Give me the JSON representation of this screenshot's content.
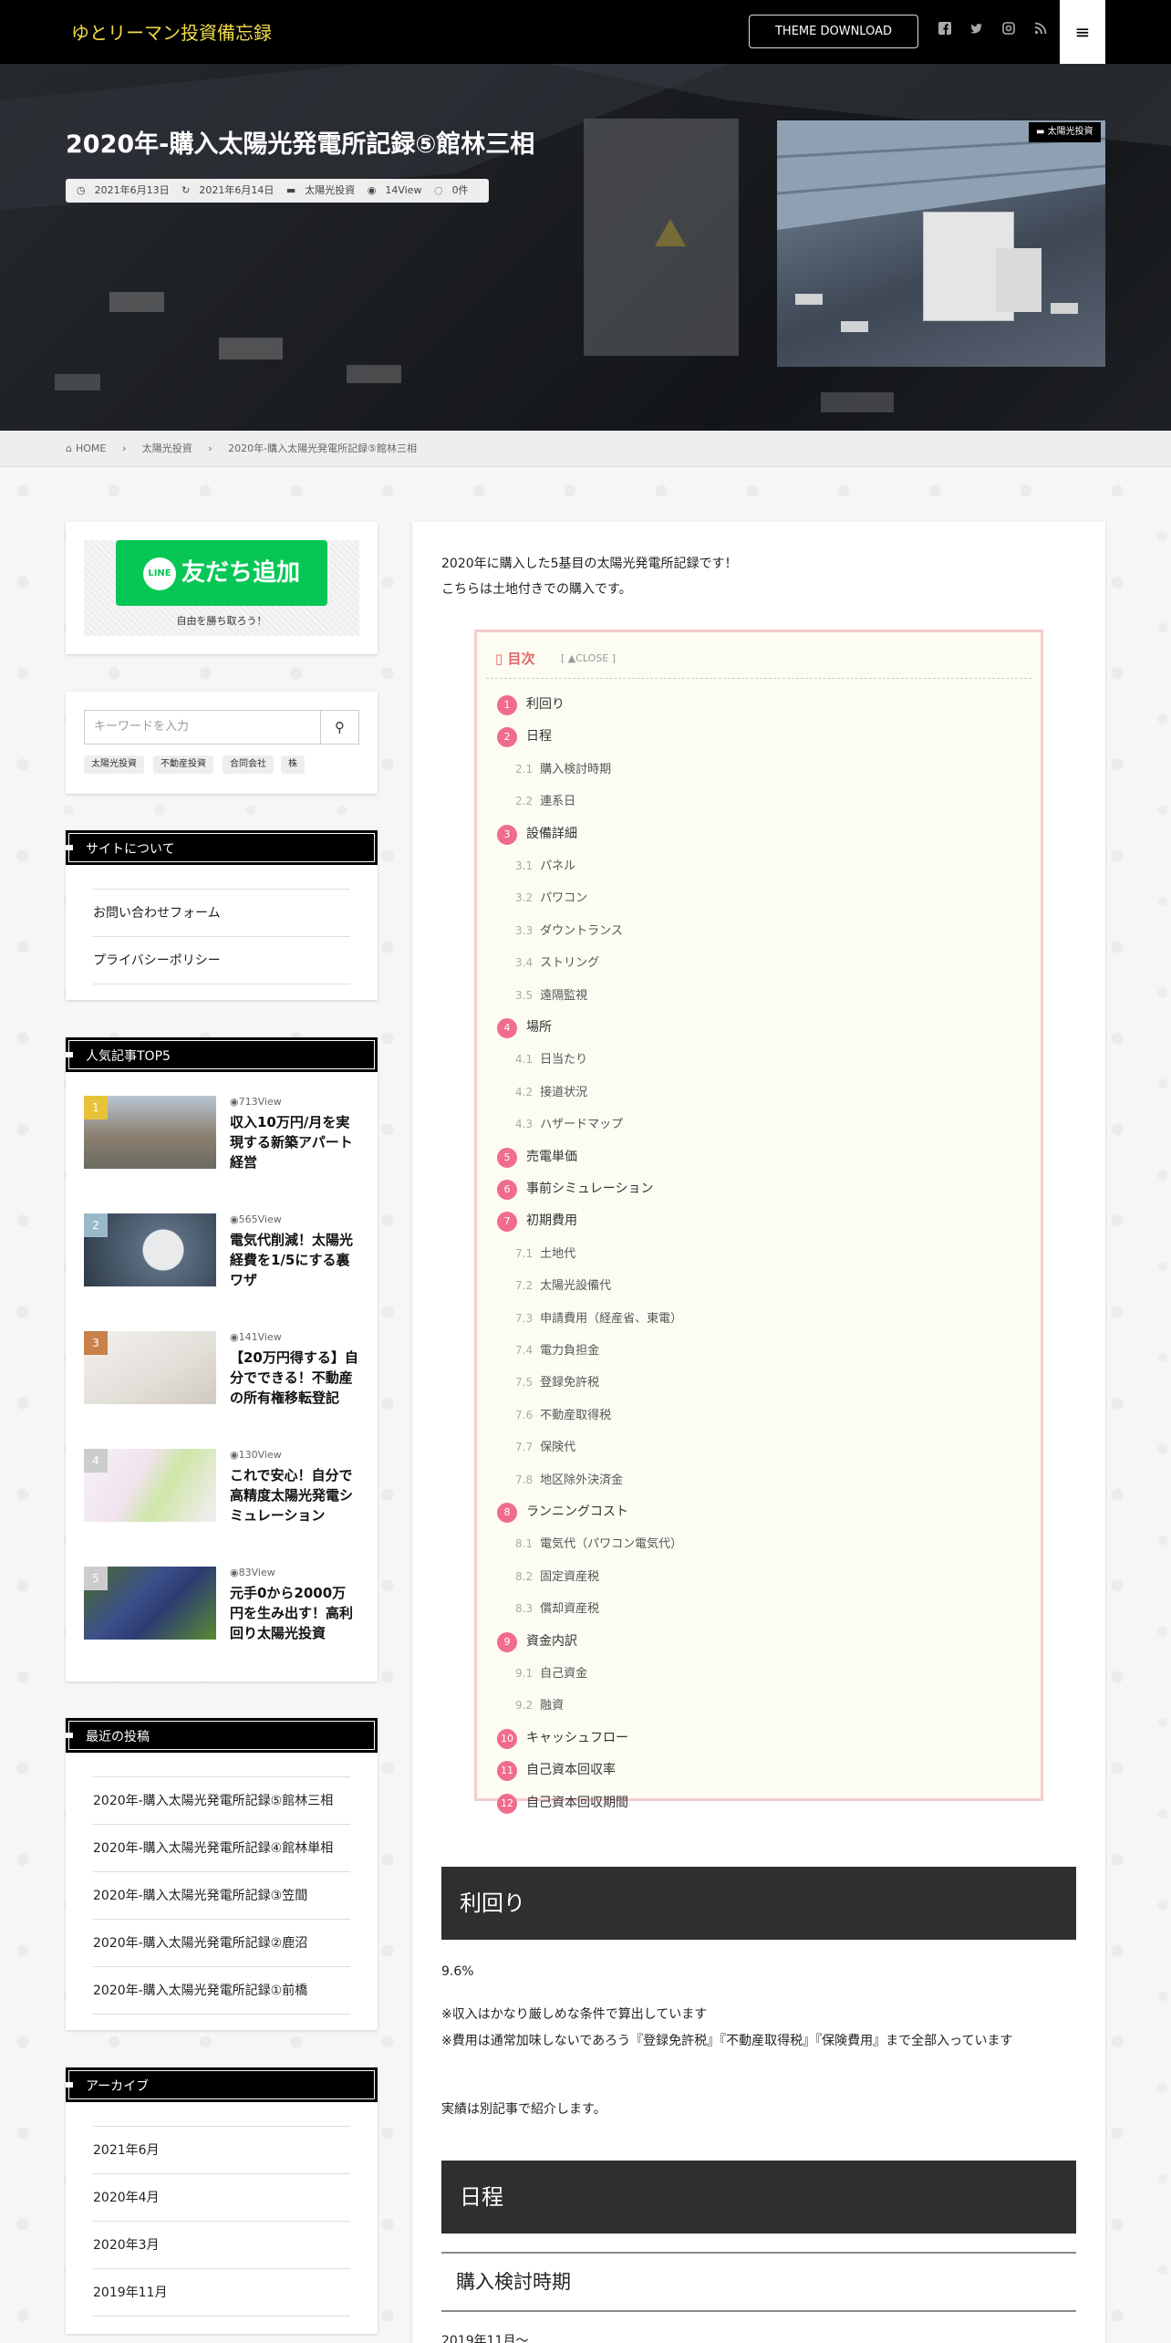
{
  "header": {
    "site_title": "ゆとリーマン投資備忘録",
    "theme_download": "THEME DOWNLOAD",
    "icons": [
      "facebook-icon",
      "twitter-icon",
      "instagram-icon",
      "rss-icon",
      "menu-icon"
    ]
  },
  "hero": {
    "title": "2020年-購入太陽光発電所記録⑤館林三相",
    "meta": {
      "posted": "2021年6月13日",
      "updated": "2021年6月14日",
      "category": "太陽光投資",
      "views": "14View",
      "comments": "0件"
    },
    "thumb_category": "太陽光投資"
  },
  "breadcrumb": [
    "HOME",
    "太陽光投資",
    "2020年-購入太陽光発電所記録⑤館林三相"
  ],
  "sidebar": {
    "line": {
      "button": "友だち追加",
      "logo": "LINE",
      "caption": "自由を勝ち取ろう！"
    },
    "search": {
      "placeholder": "キーワードを入力",
      "tags": [
        "太陽光投資",
        "不動産投資",
        "合同会社",
        "株"
      ]
    },
    "about": {
      "title": "サイトについて",
      "items": [
        "お問い合わせフォーム",
        "プライバシーポリシー"
      ]
    },
    "popular": {
      "title": "人気記事TOP5",
      "items": [
        {
          "rank": "1",
          "views": "713View",
          "title": "収入10万円/月を実現する新築アパート経営",
          "rank_color": "#e8c33a"
        },
        {
          "rank": "2",
          "views": "565View",
          "title": "電気代削減！太陽光経費を1/5にする裏ワザ",
          "rank_color": "#9ab8c8"
        },
        {
          "rank": "3",
          "views": "141View",
          "title": "【20万円得する】自分でできる！不動産の所有権移転登記",
          "rank_color": "#c8814a"
        },
        {
          "rank": "4",
          "views": "130View",
          "title": "これで安心！自分で高精度太陽光発電シミュレーション",
          "rank_color": "#cccccc"
        },
        {
          "rank": "5",
          "views": "83View",
          "title": "元手0から2000万円を生み出す！高利回り太陽光投資",
          "rank_color": "#cccccc"
        }
      ]
    },
    "recent": {
      "title": "最近の投稿",
      "items": [
        "2020年-購入太陽光発電所記録⑤館林三相",
        "2020年-購入太陽光発電所記録④館林単相",
        "2020年-購入太陽光発電所記録③笠間",
        "2020年-購入太陽光発電所記録②鹿沼",
        "2020年-購入太陽光発電所記録①前橋"
      ]
    },
    "archive": {
      "title": "アーカイブ",
      "items": [
        "2021年6月",
        "2020年4月",
        "2020年3月",
        "2019年11月"
      ]
    }
  },
  "article": {
    "intro1": "2020年に購入した5基目の太陽光発電所記録です！",
    "intro2": "こちらは土地付きでの購入です。",
    "toc": {
      "title": "目次",
      "close": "[ ▲CLOSE ]",
      "items": [
        {
          "n": "1",
          "t": "利回り",
          "lv": 1
        },
        {
          "n": "2",
          "t": "日程",
          "lv": 1
        },
        {
          "n": "2.1",
          "t": "購入検討時期",
          "lv": 2
        },
        {
          "n": "2.2",
          "t": "連系日",
          "lv": 2
        },
        {
          "n": "3",
          "t": "設備詳細",
          "lv": 1
        },
        {
          "n": "3.1",
          "t": "パネル",
          "lv": 2
        },
        {
          "n": "3.2",
          "t": "パワコン",
          "lv": 2
        },
        {
          "n": "3.3",
          "t": "ダウントランス",
          "lv": 2
        },
        {
          "n": "3.4",
          "t": "ストリング",
          "lv": 2
        },
        {
          "n": "3.5",
          "t": "遠隔監視",
          "lv": 2
        },
        {
          "n": "4",
          "t": "場所",
          "lv": 1
        },
        {
          "n": "4.1",
          "t": "日当たり",
          "lv": 2
        },
        {
          "n": "4.2",
          "t": "接道状況",
          "lv": 2
        },
        {
          "n": "4.3",
          "t": "ハザードマップ",
          "lv": 2
        },
        {
          "n": "5",
          "t": "売電単価",
          "lv": 1
        },
        {
          "n": "6",
          "t": "事前シミュレーション",
          "lv": 1
        },
        {
          "n": "7",
          "t": "初期費用",
          "lv": 1
        },
        {
          "n": "7.1",
          "t": "土地代",
          "lv": 2
        },
        {
          "n": "7.2",
          "t": "太陽光設備代",
          "lv": 2
        },
        {
          "n": "7.3",
          "t": "申請費用（経産省、東電）",
          "lv": 2
        },
        {
          "n": "7.4",
          "t": "電力負担金",
          "lv": 2
        },
        {
          "n": "7.5",
          "t": "登録免許税",
          "lv": 2
        },
        {
          "n": "7.6",
          "t": "不動産取得税",
          "lv": 2
        },
        {
          "n": "7.7",
          "t": "保険代",
          "lv": 2
        },
        {
          "n": "7.8",
          "t": "地区除外決済金",
          "lv": 2
        },
        {
          "n": "8",
          "t": "ランニングコスト",
          "lv": 1
        },
        {
          "n": "8.1",
          "t": "電気代（パワコン電気代）",
          "lv": 2
        },
        {
          "n": "8.2",
          "t": "固定資産税",
          "lv": 2
        },
        {
          "n": "8.3",
          "t": "償却資産税",
          "lv": 2
        },
        {
          "n": "9",
          "t": "資金内訳",
          "lv": 1
        },
        {
          "n": "9.1",
          "t": "自己資金",
          "lv": 2
        },
        {
          "n": "9.2",
          "t": "融資",
          "lv": 2
        },
        {
          "n": "10",
          "t": "キャッシュフロー",
          "lv": 1
        },
        {
          "n": "11",
          "t": "自己資本回収率",
          "lv": 1
        },
        {
          "n": "12",
          "t": "自己資本回収期間",
          "lv": 1
        }
      ]
    },
    "sec1_title": "利回り",
    "yield_value": "9.6%",
    "note1": "※収入はかなり厳しめな条件で算出しています",
    "note2": "※費用は通常加味しないであろう『登録免許税』『不動産取得税』『保険費用』まで全部入っています",
    "note3": "実績は別記事で紹介します。",
    "sec2_title": "日程",
    "sub2_1": "購入検討時期",
    "cut_text": "2019年11月～"
  }
}
